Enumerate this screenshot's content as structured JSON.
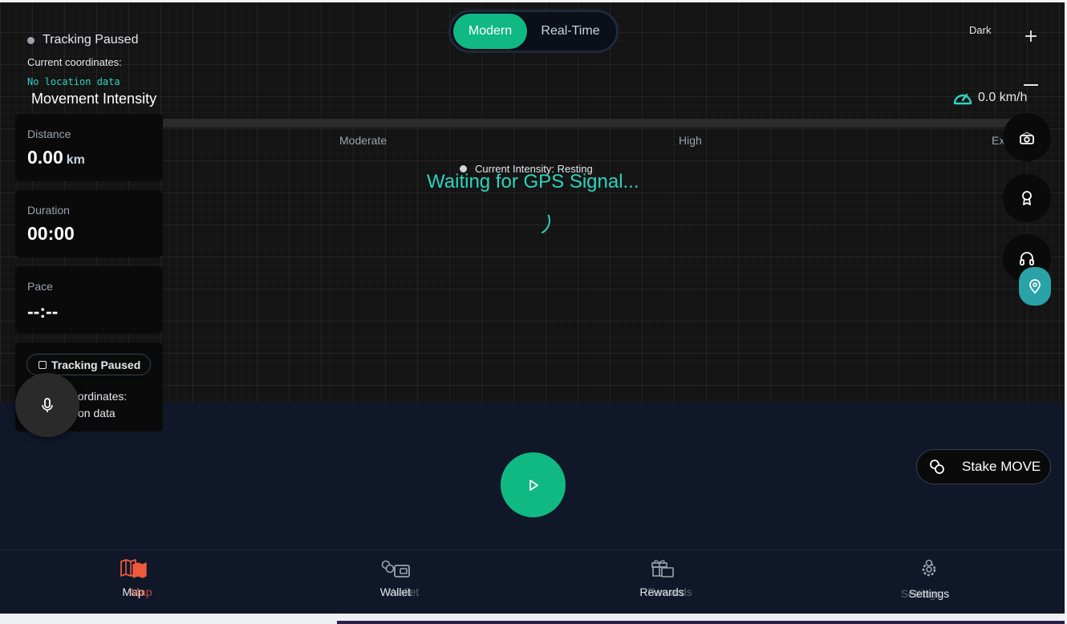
{
  "mode_toggle": {
    "active": "Modern",
    "inactive": "Real-Time"
  },
  "status": {
    "tracking": "Tracking Paused",
    "coords_label": "Current coordinates:",
    "coords_value": "No location data"
  },
  "intensity": {
    "title": "Movement Intensity",
    "levels": [
      "Moderate",
      "High",
      "Extre"
    ],
    "current": "Current Intensity: Resting"
  },
  "gps": {
    "waiting": "Waiting for GPS Signal..."
  },
  "theme": {
    "label": "Dark"
  },
  "zoom": {
    "in": "+"
  },
  "speed": {
    "value": "0.0 km/h"
  },
  "stats": {
    "distance": {
      "label": "Distance",
      "value": "0.00",
      "unit": "km"
    },
    "duration": {
      "label": "Duration",
      "value": "00:00"
    },
    "pace": {
      "label": "Pace",
      "value": "--:--"
    }
  },
  "tracking_card": {
    "pill": "Tracking Paused",
    "coords_label": "oordinates:",
    "coords_value": "on data"
  },
  "stake": {
    "label": "Stake MOVE"
  },
  "nav": [
    {
      "label": "Map",
      "ghost": "Map",
      "active": true
    },
    {
      "label": "Wallet",
      "ghost": "Wallet",
      "active": false
    },
    {
      "label": "Rewards",
      "ghost": "Rewards",
      "active": false
    },
    {
      "label": "Settings",
      "ghost": "Settings",
      "active": false
    }
  ],
  "colors": {
    "accent": "#10b981",
    "teal": "#2dd4bf",
    "nav_active": "#ef5a3c"
  }
}
